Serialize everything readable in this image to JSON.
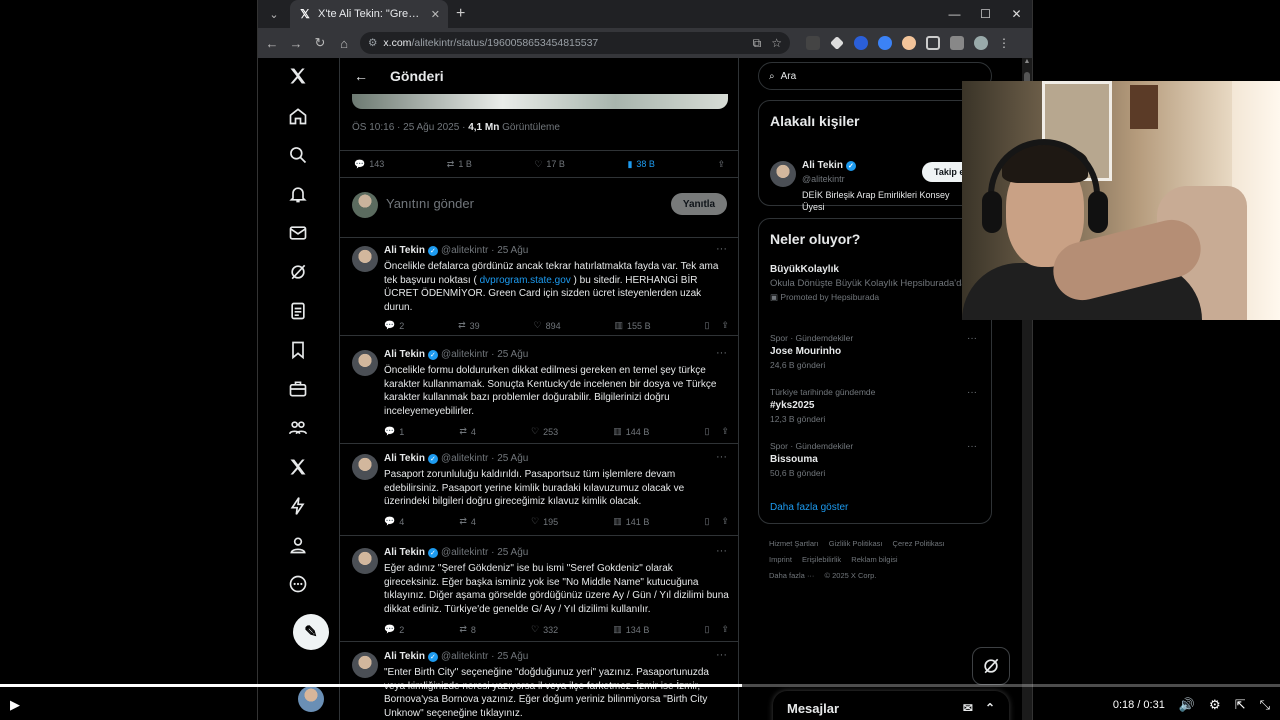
{
  "browser": {
    "tab_title": "X'te Ali Tekin: \"Green Card başv",
    "url_host": "x.com",
    "url_path": "/alitekintr/status/1960058653454815537"
  },
  "x": {
    "header_title": "Gönderi",
    "post_meta_time": "ÖS 10:16 · 25 Ağu 2025 · ",
    "post_meta_views": "4,1 Mn",
    "post_meta_views_label": " Görüntüleme",
    "stats": {
      "replies": "143",
      "reposts": "1 B",
      "likes": "17 B",
      "bookmarks": "38 B"
    },
    "reply_placeholder": "Yanıtını gönder",
    "reply_button": "Yanıtla",
    "tweets": [
      {
        "name": "Ali Tekin",
        "handle_date": "@alitekintr · 25 Ağu",
        "text_a": "Öncelikle defalarca gördünüz ancak tekrar hatırlatmakta fayda var. Tek ama tek başvuru noktası ( ",
        "link": "dvprogram.state.gov",
        "text_b": " ) bu sitedir. HERHANGİ BİR ÜCRET ÖDENMİYOR. Green Card için sizden ücret isteyenlerden uzak durun.",
        "replies": "2",
        "reposts": "39",
        "likes": "894",
        "views": "155 B"
      },
      {
        "name": "Ali Tekin",
        "handle_date": "@alitekintr · 25 Ağu",
        "text": "Öncelikle formu doldururken dikkat edilmesi gereken en temel şey türkçe karakter kullanmamak. Sonuçta Kentucky'de incelenen bir dosya ve Türkçe karakter kullanmak bazı problemler doğurabilir. Bilgilerinizi doğru inceleyemeyebilirler.",
        "replies": "1",
        "reposts": "4",
        "likes": "253",
        "views": "144 B"
      },
      {
        "name": "Ali Tekin",
        "handle_date": "@alitekintr · 25 Ağu",
        "text": "Pasaport zorunluluğu kaldırıldı. Pasaportsuz tüm işlemlere devam edebilirsiniz. Pasaport yerine kimlik buradaki kılavuzumuz olacak ve üzerindeki bilgileri doğru gireceğimiz kılavuz kimlik olacak.",
        "replies": "4",
        "reposts": "4",
        "likes": "195",
        "views": "141 B"
      },
      {
        "name": "Ali Tekin",
        "handle_date": "@alitekintr · 25 Ağu",
        "text": "Eğer adınız \"Şeref Gökdeniz\" ise bu ismi \"Seref Gokdeniz\" olarak gireceksiniz. Eğer başka isminiz yok ise \"No Middle Name\" kutucuğuna tıklayınız. Diğer aşama görselde gördüğünüz üzere Ay / Gün / Yıl dizilimi buna dikkat ediniz. Türkiye'de genelde G/ Ay / Yıl dizilimi kullanılır.",
        "replies": "2",
        "reposts": "8",
        "likes": "332",
        "views": "134 B"
      },
      {
        "name": "Ali Tekin",
        "handle_date": "@alitekintr · 25 Ağu",
        "text": "\"Enter Birth City\" seçeneğine \"doğduğunuz yeri\" yazınız. Pasaportunuzda veya kimliğinizde neresi yazıyorsa il veya ilçe farketmez. İzmir ise İzmir, Bornova'ysa Bornova yazınız. Eğer doğum yeriniz bilinmiyorsa \"Birth City Unknow\" seçeneğine tıklayınız."
      }
    ],
    "search_placeholder": "Ara",
    "people": {
      "title": "Alakalı kişiler",
      "name": "Ali Tekin",
      "handle": "@alitekintr",
      "follow": "Takip e",
      "bio": "DEİK Birleşik Arap Emirlikleri Konsey Üyesi"
    },
    "trends": {
      "title": "Neler oluyor?",
      "promo_title": "BüyükKolaylık",
      "promo_sub": "Okula Dönüşte Büyük Kolaylık Hepsiburada'da!",
      "promo_note": "Promoted by Hepsiburada",
      "items": [
        {
          "ctx": "Spor · Gündemdekiler",
          "title": "Jose Mourinho",
          "count": "24,6 B gönderi"
        },
        {
          "ctx": "Türkiye tarihinde gündemde",
          "title": "#yks2025",
          "count": "12,3 B gönderi"
        },
        {
          "ctx": "Spor · Gündemdekiler",
          "title": "Bissouma",
          "count": "50,6 B gönderi"
        }
      ],
      "show_more": "Daha fazla göster"
    },
    "footer": [
      "Hizmet Şartları",
      "Gizlilik Politikası",
      "Çerez Politikası",
      "Imprint",
      "Erişilebilirlik",
      "Reklam bilgisi",
      "Daha fazla ···",
      "© 2025 X Corp."
    ],
    "messages": "Mesajlar"
  },
  "player": {
    "time": "0:18 / 0:31",
    "progress": 0.58
  }
}
